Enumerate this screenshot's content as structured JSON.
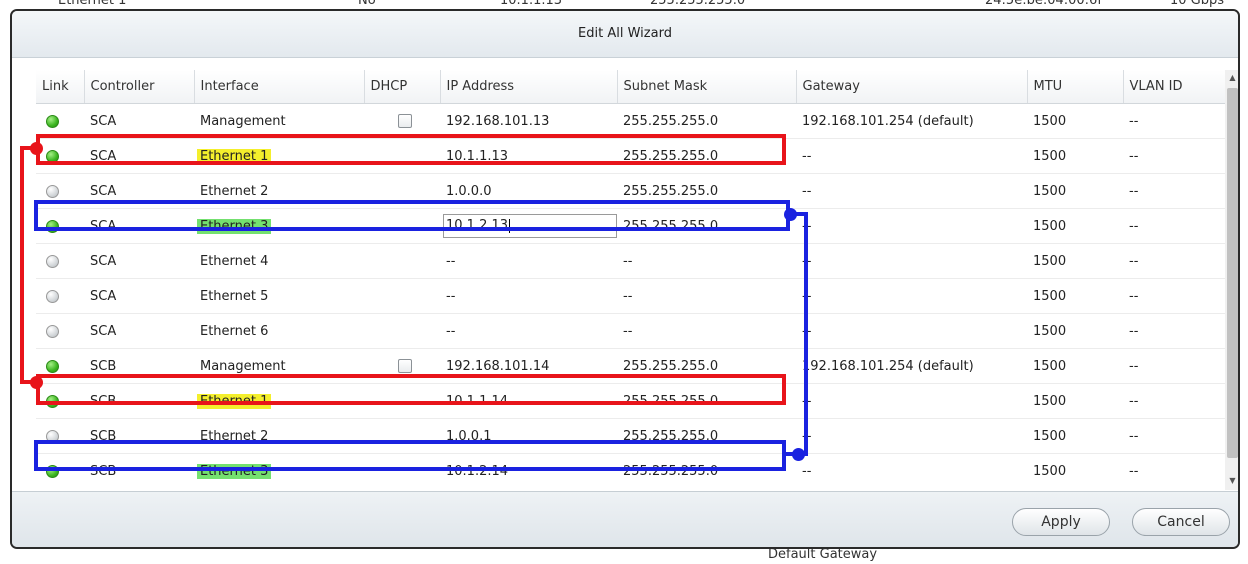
{
  "background": {
    "top_cells": [
      "Ethernet 1",
      "No",
      "10.1.1.13",
      "255.255.255.0",
      "24:5e:be:04:00:6f",
      "10 Gbps"
    ],
    "bottom_label": "Default Gateway"
  },
  "dialog": {
    "title": "Edit All Wizard",
    "apply_label": "Apply",
    "cancel_label": "Cancel"
  },
  "columns": [
    "Link",
    "Controller",
    "Interface",
    "DHCP",
    "IP Address",
    "Subnet Mask",
    "Gateway",
    "MTU",
    "VLAN ID"
  ],
  "rows": [
    {
      "link": "up",
      "controller": "SCA",
      "interface": "Management",
      "dhcp": true,
      "ip": "192.168.101.13",
      "mask": "255.255.255.0",
      "gateway": "192.168.101.254 (default)",
      "mtu": "1500",
      "vlan": "--",
      "highlight": ""
    },
    {
      "link": "up",
      "controller": "SCA",
      "interface": "Ethernet 1",
      "dhcp": false,
      "ip": "10.1.1.13",
      "mask": "255.255.255.0",
      "gateway": "--",
      "mtu": "1500",
      "vlan": "--",
      "highlight": "yellow"
    },
    {
      "link": "down",
      "controller": "SCA",
      "interface": "Ethernet 2",
      "dhcp": false,
      "ip": "1.0.0.0",
      "mask": "255.255.255.0",
      "gateway": "--",
      "mtu": "1500",
      "vlan": "--",
      "highlight": ""
    },
    {
      "link": "up",
      "controller": "SCA",
      "interface": "Ethernet 3",
      "dhcp": false,
      "ip": "10.1.2.13",
      "mask": "255.255.255.0",
      "gateway": "--",
      "mtu": "1500",
      "vlan": "--",
      "highlight": "green",
      "editing": true
    },
    {
      "link": "down",
      "controller": "SCA",
      "interface": "Ethernet 4",
      "dhcp": false,
      "ip": "--",
      "mask": "--",
      "gateway": "--",
      "mtu": "1500",
      "vlan": "--",
      "highlight": ""
    },
    {
      "link": "down",
      "controller": "SCA",
      "interface": "Ethernet 5",
      "dhcp": false,
      "ip": "--",
      "mask": "--",
      "gateway": "--",
      "mtu": "1500",
      "vlan": "--",
      "highlight": ""
    },
    {
      "link": "down",
      "controller": "SCA",
      "interface": "Ethernet 6",
      "dhcp": false,
      "ip": "--",
      "mask": "--",
      "gateway": "--",
      "mtu": "1500",
      "vlan": "--",
      "highlight": ""
    },
    {
      "link": "up",
      "controller": "SCB",
      "interface": "Management",
      "dhcp": true,
      "ip": "192.168.101.14",
      "mask": "255.255.255.0",
      "gateway": "192.168.101.254 (default)",
      "mtu": "1500",
      "vlan": "--",
      "highlight": ""
    },
    {
      "link": "up",
      "controller": "SCB",
      "interface": "Ethernet 1",
      "dhcp": false,
      "ip": "10.1.1.14",
      "mask": "255.255.255.0",
      "gateway": "--",
      "mtu": "1500",
      "vlan": "--",
      "highlight": "yellow"
    },
    {
      "link": "down",
      "controller": "SCB",
      "interface": "Ethernet 2",
      "dhcp": false,
      "ip": "1.0.0.1",
      "mask": "255.255.255.0",
      "gateway": "--",
      "mtu": "1500",
      "vlan": "--",
      "highlight": ""
    },
    {
      "link": "up",
      "controller": "SCB",
      "interface": "Ethernet 3",
      "dhcp": false,
      "ip": "10.1.2.14",
      "mask": "255.255.255.0",
      "gateway": "--",
      "mtu": "1500",
      "vlan": "--",
      "highlight": "green"
    },
    {
      "link": "down",
      "controller": "",
      "interface": "",
      "dhcp": false,
      "ip": "",
      "mask": "",
      "gateway": "",
      "mtu": "",
      "vlan": "",
      "highlight": ""
    }
  ],
  "colors": {
    "annotation_red": "#e8141a",
    "annotation_blue": "#1a22e0",
    "link_up": "#3cb521",
    "link_down": "#d3d7da"
  }
}
